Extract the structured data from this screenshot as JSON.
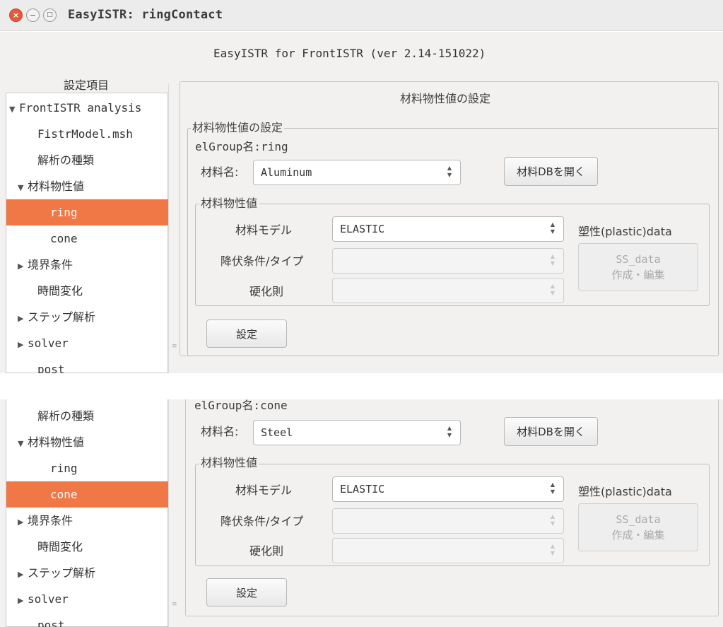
{
  "window": {
    "title": "EasyISTR: ringContact",
    "close_glyph": "×",
    "min_glyph": "−",
    "max_glyph": "□"
  },
  "app_title": "EasyISTR for FrontISTR  (ver 2.14-151022)",
  "sidebar": {
    "header": "設定項目",
    "tree_top": [
      {
        "label": "FrontISTR analysis",
        "indent": 0,
        "expander": "▼",
        "selected": false
      },
      {
        "label": "FistrModel.msh",
        "indent": 1,
        "expander": "",
        "selected": false
      },
      {
        "label": "解析の種類",
        "indent": 1,
        "expander": "",
        "selected": false
      },
      {
        "label": "材料物性値",
        "indent": 1,
        "expander": "▼",
        "selected": false
      },
      {
        "label": "ring",
        "indent": 2,
        "expander": "",
        "selected": true
      },
      {
        "label": "cone",
        "indent": 2,
        "expander": "",
        "selected": false
      },
      {
        "label": "境界条件",
        "indent": 1,
        "expander": "▶",
        "selected": false
      },
      {
        "label": "時間変化",
        "indent": 1,
        "expander": "",
        "selected": false
      },
      {
        "label": "ステップ解析",
        "indent": 1,
        "expander": "▶",
        "selected": false
      },
      {
        "label": "solver",
        "indent": 1,
        "expander": "▶",
        "selected": false
      },
      {
        "label": "post",
        "indent": 1,
        "expander": "",
        "selected": false
      }
    ],
    "tree_bottom": [
      {
        "label": "解析の種類",
        "indent": 1,
        "expander": "",
        "selected": false
      },
      {
        "label": "材料物性値",
        "indent": 1,
        "expander": "▼",
        "selected": false
      },
      {
        "label": "ring",
        "indent": 2,
        "expander": "",
        "selected": false
      },
      {
        "label": "cone",
        "indent": 2,
        "expander": "",
        "selected": true
      },
      {
        "label": "境界条件",
        "indent": 1,
        "expander": "▶",
        "selected": false
      },
      {
        "label": "時間変化",
        "indent": 1,
        "expander": "",
        "selected": false
      },
      {
        "label": "ステップ解析",
        "indent": 1,
        "expander": "▶",
        "selected": false
      },
      {
        "label": "solver",
        "indent": 1,
        "expander": "▶",
        "selected": false
      },
      {
        "label": "post",
        "indent": 1,
        "expander": "",
        "selected": false
      }
    ]
  },
  "panel_top": {
    "heading": "材料物性値の設定",
    "group_title": "材料物性値の設定",
    "elgroup": "elGroup名:ring",
    "material_label": "材料名:",
    "material_value": "Aluminum",
    "open_db_button": "材料DBを開く",
    "props_title": "材料物性値",
    "model_label": "材料モデル",
    "model_value": "ELASTIC",
    "yield_label": "降伏条件/タイプ",
    "hardening_label": "硬化則",
    "plastic_label": "塑性(plastic)data",
    "ss_button_line1": "SS_data",
    "ss_button_line2": "作成・編集",
    "set_button": "設定"
  },
  "panel_bottom": {
    "elgroup": "elGroup名:cone",
    "material_label": "材料名:",
    "material_value": "Steel",
    "open_db_button": "材料DBを開く",
    "props_title": "材料物性値",
    "model_label": "材料モデル",
    "model_value": "ELASTIC",
    "yield_label": "降伏条件/タイプ",
    "hardening_label": "硬化則",
    "plastic_label": "塑性(plastic)data",
    "ss_button_line1": "SS_data",
    "ss_button_line2": "作成・編集",
    "set_button": "設定"
  },
  "colors": {
    "selection": "#f07746",
    "window_bg": "#f2f1f0",
    "close_button": "#e25c3c"
  },
  "icons": {
    "combo_arrows": "⌃⌄",
    "expanded": "▼",
    "collapsed": "▶"
  }
}
